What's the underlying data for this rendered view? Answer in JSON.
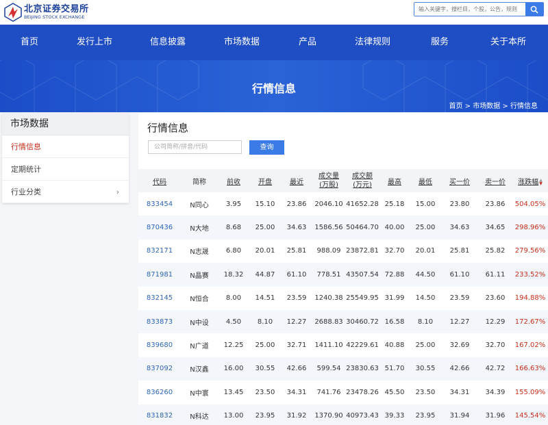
{
  "logo": {
    "name_cn": "北京证券交易所",
    "name_en": "BEIJING STOCK EXCHANGE"
  },
  "search": {
    "placeholder": "输入关键字，搜栏目，个股，公告，规则"
  },
  "nav": [
    "首页",
    "发行上市",
    "信息披露",
    "市场数据",
    "产品",
    "法律规则",
    "服务",
    "关于本所"
  ],
  "banner": {
    "title": "行情信息"
  },
  "breadcrumb": {
    "home": "首页",
    "sep1": ">",
    "section": "市场数据",
    "sep2": ">",
    "current": "行情信息"
  },
  "sidebar": {
    "title": "市场数据",
    "items": [
      {
        "label": "行情信息"
      },
      {
        "label": "定期统计"
      },
      {
        "label": "行业分类"
      }
    ]
  },
  "panel": {
    "title": "行情信息",
    "input_placeholder": "公司简称/拼音/代码",
    "query_label": "查询"
  },
  "table": {
    "headers": [
      "代码",
      "简称",
      "前收",
      "开盘",
      "最近",
      "成交量\n(万股)",
      "成交额\n(万元)",
      "最高",
      "最低",
      "买一价",
      "卖一价",
      "涨跌幅"
    ],
    "rows": [
      [
        "833454",
        "N同心",
        "3.95",
        "15.10",
        "23.86",
        "2046.10",
        "41652.28",
        "25.18",
        "15.00",
        "23.80",
        "23.86",
        "504.05%"
      ],
      [
        "870436",
        "N大地",
        "8.68",
        "25.00",
        "34.63",
        "1586.56",
        "50464.70",
        "40.00",
        "25.00",
        "34.63",
        "34.65",
        "298.96%"
      ],
      [
        "832171",
        "N志晟",
        "6.80",
        "20.01",
        "25.81",
        "988.09",
        "23872.81",
        "32.70",
        "20.01",
        "25.81",
        "25.82",
        "279.56%"
      ],
      [
        "871981",
        "N晶赛",
        "18.32",
        "44.87",
        "61.10",
        "778.51",
        "43507.54",
        "72.88",
        "44.50",
        "61.10",
        "61.11",
        "233.52%"
      ],
      [
        "832145",
        "N恒合",
        "8.00",
        "14.51",
        "23.59",
        "1240.38",
        "25549.95",
        "31.99",
        "14.50",
        "23.59",
        "23.60",
        "194.88%"
      ],
      [
        "833873",
        "N中设",
        "4.50",
        "8.10",
        "12.27",
        "2688.83",
        "30460.72",
        "16.58",
        "8.10",
        "12.27",
        "12.29",
        "172.67%"
      ],
      [
        "839680",
        "N广道",
        "12.25",
        "25.00",
        "32.71",
        "1411.10",
        "42229.61",
        "40.88",
        "25.00",
        "32.69",
        "32.70",
        "167.02%"
      ],
      [
        "837092",
        "N汉鑫",
        "16.00",
        "30.55",
        "42.66",
        "599.54",
        "23830.63",
        "51.70",
        "30.55",
        "42.66",
        "42.72",
        "166.63%"
      ],
      [
        "836260",
        "N中寰",
        "13.45",
        "23.50",
        "34.31",
        "741.76",
        "23478.26",
        "45.50",
        "23.50",
        "34.31",
        "34.39",
        "155.09%"
      ],
      [
        "831832",
        "N科达",
        "13.00",
        "23.95",
        "31.92",
        "1370.90",
        "40973.43",
        "39.33",
        "23.95",
        "31.94",
        "31.96",
        "145.54%"
      ]
    ]
  },
  "colors": {
    "nav_blue": "#1f4ec4",
    "accent_blue": "#3b7be8",
    "up_red": "#c72d1a",
    "code_blue": "#2d64b5"
  },
  "icons": {
    "search": "search-icon",
    "chevron": "chevron-right-icon",
    "sort": "sort-caret-icon"
  }
}
